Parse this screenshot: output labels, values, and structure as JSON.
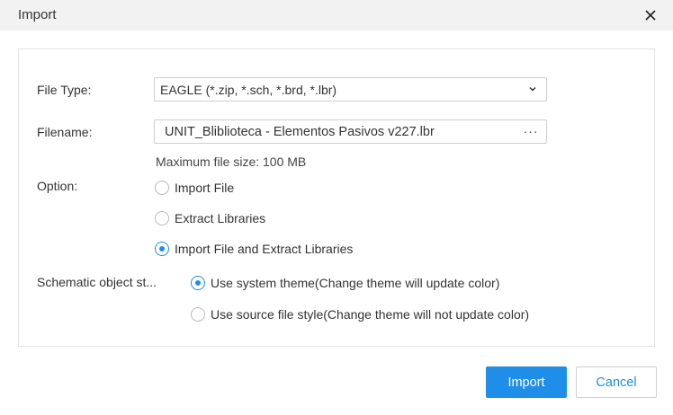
{
  "dialog": {
    "title": "Import",
    "close_icon": "close-icon"
  },
  "form": {
    "file_type": {
      "label": "File Type:",
      "value": "EAGLE (*.zip, *.sch, *.brd, *.lbr)",
      "icon": "chevron-down-icon"
    },
    "filename": {
      "label": "Filename:",
      "value": "UNIT_Bliblioteca - Elementos Pasivos v227.lbr",
      "browse_label": "···",
      "hint": "Maximum file size: 100 MB"
    },
    "option": {
      "label": "Option:",
      "choices": [
        {
          "label": "Import File",
          "selected": false
        },
        {
          "label": "Extract Libraries",
          "selected": false
        },
        {
          "label": "Import File and Extract Libraries",
          "selected": true
        }
      ]
    },
    "schematic_style": {
      "label": "Schematic object st...",
      "choices": [
        {
          "label": "Use system theme(Change theme will update color)",
          "selected": true
        },
        {
          "label": "Use source file style(Change theme will not update color)",
          "selected": false
        }
      ]
    }
  },
  "buttons": {
    "import_label": "Import",
    "cancel_label": "Cancel"
  },
  "colors": {
    "accent": "#1f8ee8",
    "titlebar": "#f2f2f2"
  }
}
